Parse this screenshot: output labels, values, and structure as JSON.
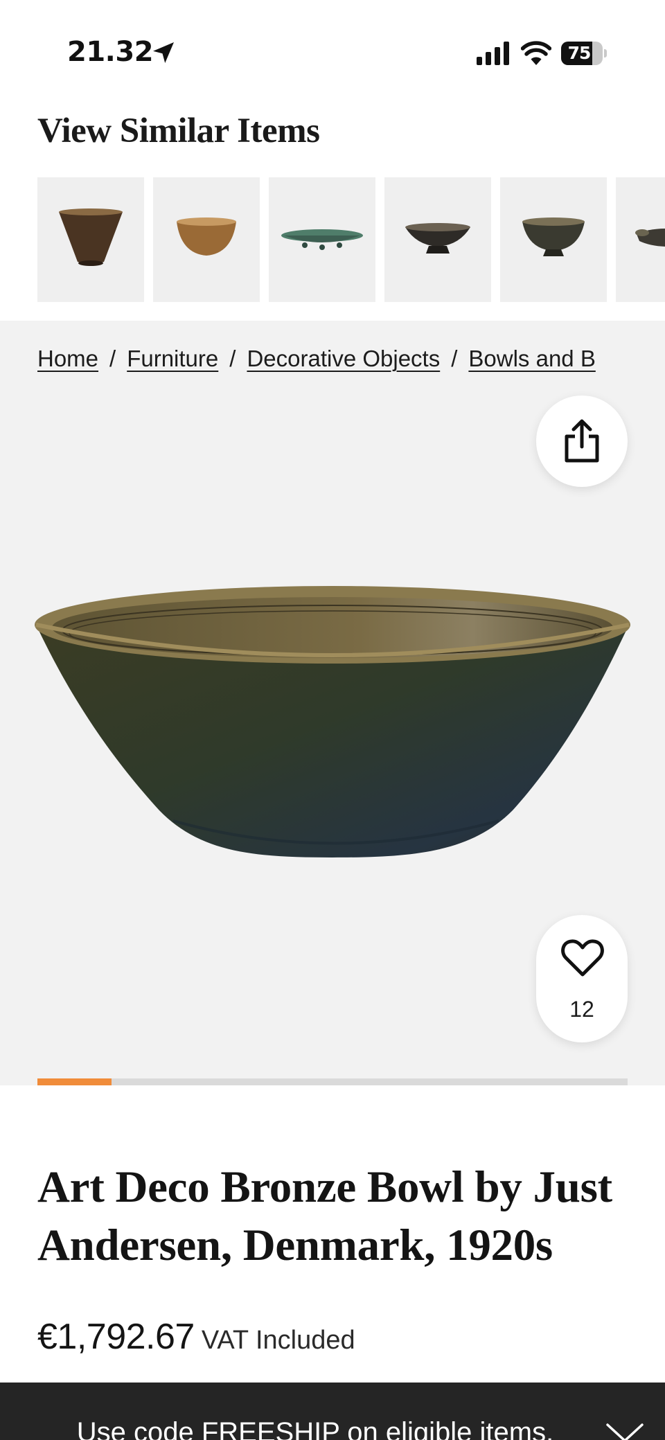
{
  "status_bar": {
    "time": "21.32",
    "battery": "75",
    "battery_level": 0.75,
    "icons": [
      "location-arrow-icon",
      "cellular-signal-icon",
      "wifi-icon",
      "battery-icon"
    ]
  },
  "similar_items": {
    "title": "View Similar Items",
    "items": [
      {
        "icon": "conical-bronze-bowl",
        "color": "#4a3422"
      },
      {
        "icon": "copper-bowl",
        "color": "#9a6a36"
      },
      {
        "icon": "green-footed-dish",
        "color": "#4f7d6a"
      },
      {
        "icon": "dark-footed-bowl",
        "color": "#2e2b27"
      },
      {
        "icon": "dark-pedestal-bowl",
        "color": "#3a3a30"
      },
      {
        "icon": "partial-bowl",
        "color": "#3d3a33"
      }
    ]
  },
  "breadcrumbs": [
    "Home",
    "Furniture",
    "Decorative Objects",
    "Bowls and B"
  ],
  "breadcrumb_separator": "/",
  "gallery": {
    "image": "bronze-bowl",
    "share_icon": "share-icon",
    "favorite_icon": "heart-icon",
    "favorites_count": "12",
    "image_position": 1,
    "progress_fraction": 0.125
  },
  "product": {
    "title": "Art Deco Bronze Bowl by Just Andersen, Denmark, 1920s",
    "price": "€1,792.67",
    "vat": "VAT Included"
  },
  "promo": {
    "text": "Use code FREESHIP on eligible items.",
    "icon": "chevron-down-icon"
  },
  "colors": {
    "accent": "#f08c3a",
    "gallery_background": "#f2f2f2",
    "promo_background": "#252525"
  }
}
